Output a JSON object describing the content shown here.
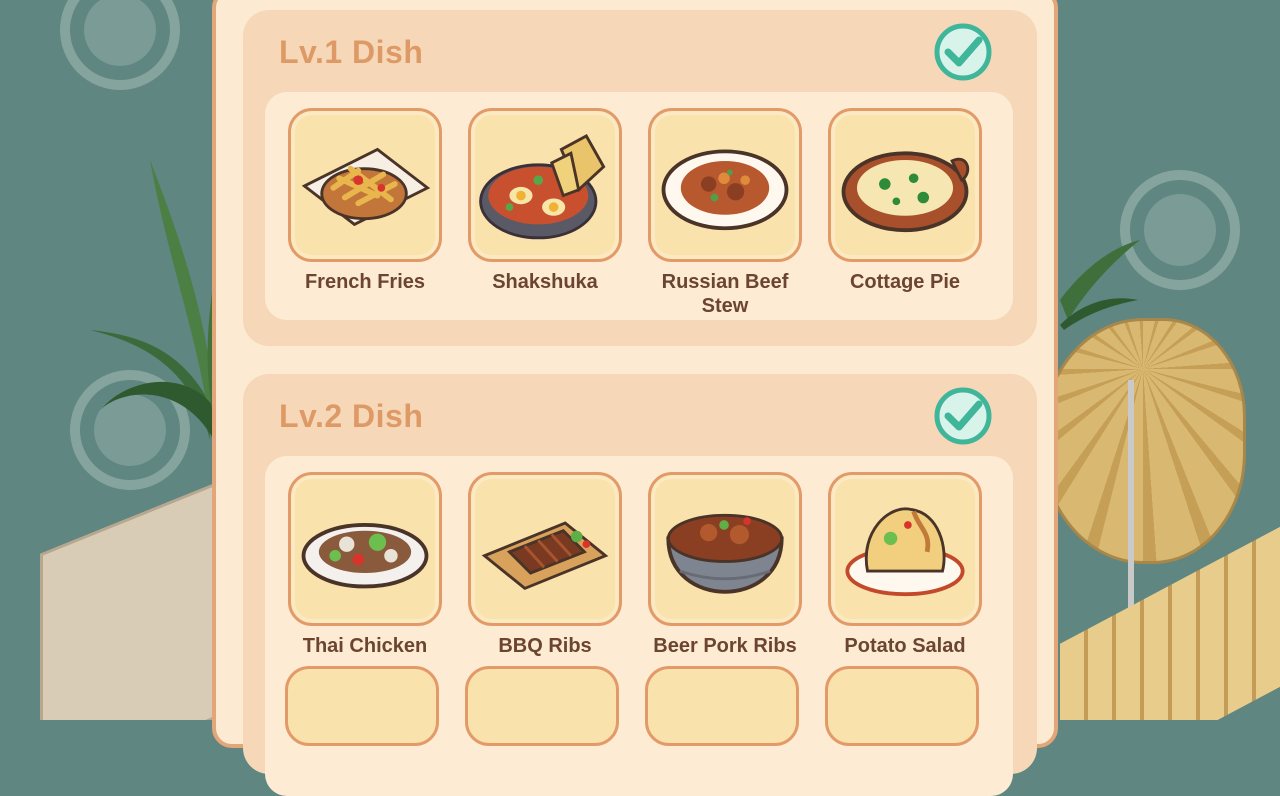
{
  "sections": [
    {
      "title": "Lv.1 Dish",
      "completed": true,
      "dishes": [
        {
          "name": "French Fries",
          "icon": "french-fries-icon"
        },
        {
          "name": "Shakshuka",
          "icon": "shakshuka-icon"
        },
        {
          "name": "Russian Beef Stew",
          "icon": "russian-beef-stew-icon"
        },
        {
          "name": "Cottage Pie",
          "icon": "cottage-pie-icon"
        }
      ]
    },
    {
      "title": "Lv.2 Dish",
      "completed": true,
      "dishes": [
        {
          "name": "Thai Chicken",
          "icon": "thai-chicken-icon"
        },
        {
          "name": "BBQ Ribs",
          "icon": "bbq-ribs-icon"
        },
        {
          "name": "Beer Pork Ribs",
          "icon": "beer-pork-ribs-icon"
        },
        {
          "name": "Potato Salad",
          "icon": "potato-salad-icon"
        }
      ]
    }
  ],
  "colors": {
    "panel_bg": "#fcebd2",
    "section_bg": "#f6d8b8",
    "title": "#de9a66",
    "tile_border": "#e39a69",
    "dish_text": "#6b4531",
    "check": "#3fb59a"
  }
}
